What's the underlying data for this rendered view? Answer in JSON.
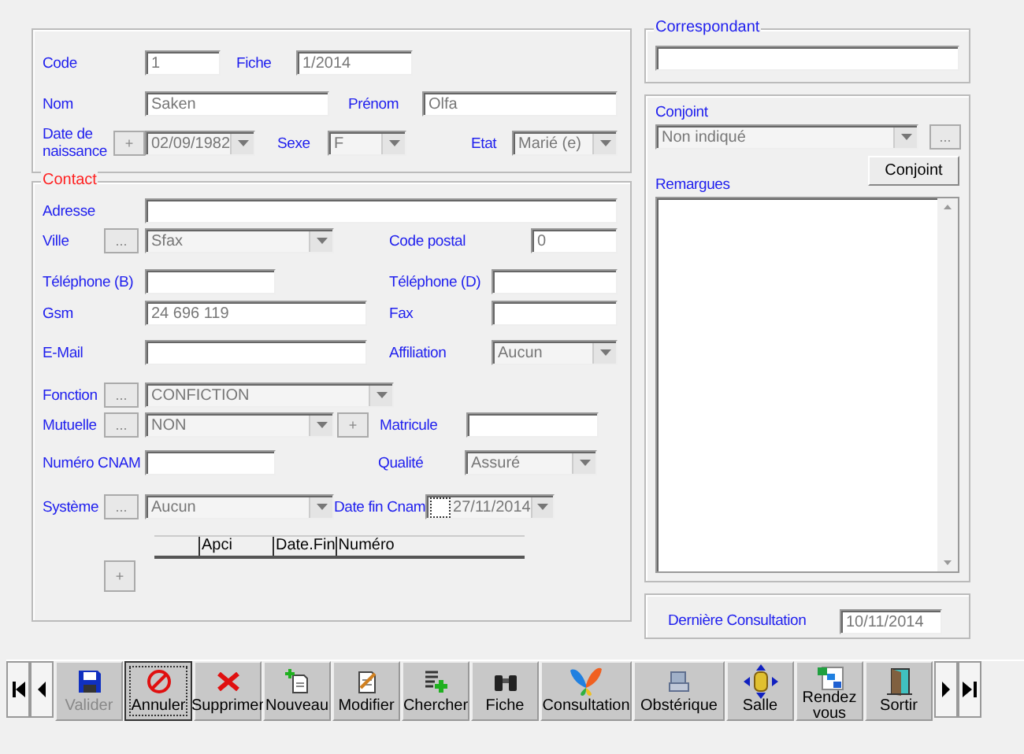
{
  "general": {
    "code": {
      "label": "Code",
      "value": "1"
    },
    "fiche": {
      "label": "Fiche",
      "value": "1/2014"
    },
    "nom": {
      "label": "Nom",
      "value": "Saken"
    },
    "prenom": {
      "label": "Prénom",
      "value": "Olfa"
    },
    "naissance": {
      "label": "Date de naissance",
      "button": "+",
      "value": "02/09/1982"
    },
    "sexe": {
      "label": "Sexe",
      "value": "F"
    },
    "etat": {
      "label": "Etat",
      "value": "Marié (e)"
    }
  },
  "contact": {
    "title": "Contact",
    "adresse": {
      "label": "Adresse"
    },
    "ville": {
      "label": "Ville",
      "button": "...",
      "value": "Sfax"
    },
    "code_postal": {
      "label": "Code postal",
      "value": "0"
    },
    "telephone_b": {
      "label": "Téléphone (B)"
    },
    "telephone_d": {
      "label": "Téléphone (D)"
    },
    "gsm": {
      "label": "Gsm",
      "value": "24 696 119"
    },
    "fax": {
      "label": "Fax"
    },
    "email": {
      "label": "E-Mail"
    },
    "affiliation": {
      "label": "Affiliation",
      "value": "Aucun"
    },
    "fonction": {
      "label": "Fonction",
      "button": "...",
      "value": "CONFICTION"
    },
    "mutuelle": {
      "label": "Mutuelle",
      "button": "...",
      "value": "NON",
      "add_button": "+"
    },
    "matricule": {
      "label": "Matricule"
    },
    "numero_cnam": {
      "label": "Numéro CNAM"
    },
    "qualite": {
      "label": "Qualité",
      "value": "Assuré"
    },
    "systeme": {
      "label": "Système",
      "button": "...",
      "value": "Aucun"
    },
    "date_fin_cnam": {
      "label": "Date fin Cnam",
      "checked": false,
      "value": "27/11/2014"
    },
    "table": {
      "columns": [
        "Apci",
        "Date.Fin",
        "Numéro"
      ]
    },
    "add_button": "+"
  },
  "correspondant": {
    "title": "Correspondant"
  },
  "conjoint": {
    "label": "Conjoint",
    "value": "Non indiqué",
    "browse_button": "...",
    "button": "Conjoint",
    "remarks_label": "Remargues"
  },
  "derniere_consultation": {
    "label": "Dernière Consultation",
    "value": "10/11/2014"
  },
  "toolbar": [
    {
      "label": "Valider",
      "disabled": true,
      "focused": false
    },
    {
      "label": "Annuler",
      "disabled": false,
      "focused": true
    },
    {
      "label": "Supprimer",
      "disabled": false,
      "focused": false
    },
    {
      "label": "Nouveau",
      "disabled": false,
      "focused": false
    },
    {
      "label": "Modifier",
      "disabled": false,
      "focused": false
    },
    {
      "label": "Chercher",
      "disabled": false,
      "focused": false
    },
    {
      "label": "Fiche",
      "disabled": false,
      "focused": false
    },
    {
      "label": "Consultation",
      "disabled": false,
      "focused": false
    },
    {
      "label": "Obstérique",
      "disabled": false,
      "focused": false
    },
    {
      "label": "Salle",
      "disabled": false,
      "focused": false
    },
    {
      "label": "Rendez vous",
      "disabled": false,
      "focused": false
    },
    {
      "label": "Sortir",
      "disabled": false,
      "focused": false
    }
  ]
}
